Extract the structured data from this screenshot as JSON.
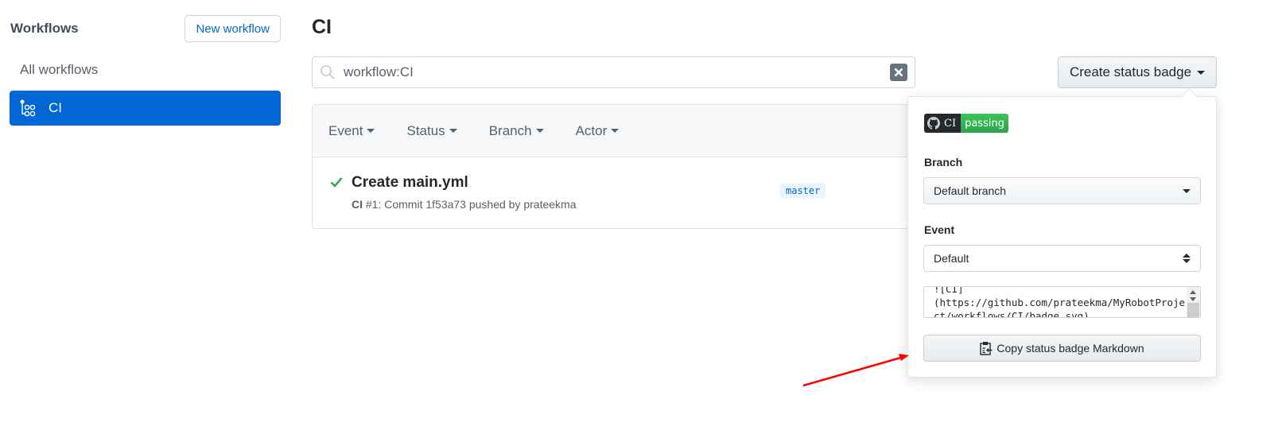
{
  "sidebar": {
    "title": "Workflows",
    "new_workflow_label": "New workflow",
    "items": [
      {
        "label": "All workflows",
        "icon": null,
        "selected": false
      },
      {
        "label": "CI",
        "icon": "workflow-icon",
        "selected": true
      }
    ]
  },
  "main": {
    "title": "CI",
    "search": {
      "value": "workflow:CI",
      "icon": "search-icon",
      "clear_icon": "close-icon"
    },
    "filters": [
      {
        "label": "Event"
      },
      {
        "label": "Status"
      },
      {
        "label": "Branch"
      },
      {
        "label": "Actor"
      }
    ],
    "runs": [
      {
        "status": "success",
        "status_icon": "check-icon",
        "title": "Create main.yml",
        "workflow": "CI",
        "meta": "#1: Commit 1f53a73 pushed by prateekma",
        "branch": "master"
      }
    ]
  },
  "badge_menu": {
    "button_label": "Create status badge",
    "preview": {
      "label": "CI",
      "status": "passing",
      "label_color": "#24292e",
      "status_color": "#2ea44f"
    },
    "branch_label": "Branch",
    "branch_value": "Default branch",
    "event_label": "Event",
    "event_value": "Default",
    "markdown": "![CI](https://github.com/prateekma/MyRobotProject/workflows/CI/badge.svg)",
    "copy_label": "Copy status badge Markdown"
  },
  "annotation": {
    "type": "arrow",
    "color": "#ff0000",
    "points_to": "copy-status-badge-button"
  },
  "colors": {
    "accent": "#0366d6",
    "success": "#28a745"
  }
}
